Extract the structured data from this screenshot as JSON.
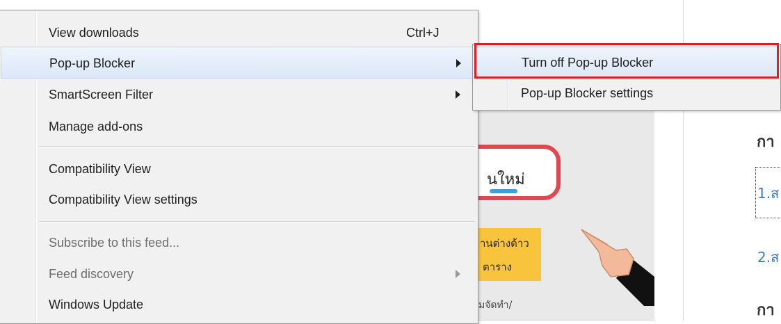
{
  "menu": {
    "items": [
      {
        "label": "View downloads",
        "shortcut": "Ctrl+J"
      },
      {
        "label": "Pop-up Blocker"
      },
      {
        "label": "SmartScreen Filter"
      },
      {
        "label": "Manage add-ons"
      },
      {
        "label": "Compatibility View"
      },
      {
        "label": "Compatibility View settings"
      },
      {
        "label": "Subscribe to this feed..."
      },
      {
        "label": "Feed discovery"
      },
      {
        "label": "Windows Update"
      }
    ]
  },
  "submenu": {
    "items": [
      {
        "label": "Turn off Pop-up Blocker"
      },
      {
        "label": "Pop-up Blocker settings"
      }
    ]
  },
  "background": {
    "card_text": "นใหม่",
    "yellow_line_1": "านต่างด้าว",
    "yellow_line_2": "ตาราง",
    "small_text": "มจัดทำ/",
    "right_headings": [
      "กา",
      "กา"
    ],
    "right_links": [
      "1.ส",
      "2.ส"
    ],
    "colors": {
      "highlight_outline": "#e21f26",
      "link": "#3a7bc8"
    }
  }
}
